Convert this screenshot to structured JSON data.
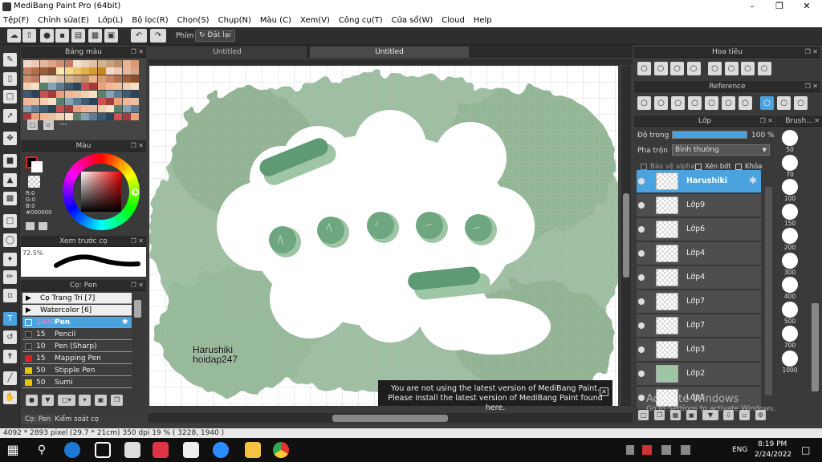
{
  "window": {
    "title": "MediBang Paint Pro (64bit)"
  },
  "menu": [
    "Tệp(F)",
    "Chỉnh sửa(E)",
    "Lớp(L)",
    "Bộ lọc(R)",
    "Chọn(S)",
    "Chụp(N)",
    "Màu (C)",
    "Xem(V)",
    "Công cụ(T)",
    "Cửa sổ(W)",
    "Cloud",
    "Help"
  ],
  "toolbar": {
    "shortcut_label": "Phím",
    "reset_label": "Đặt lại"
  },
  "panels": {
    "palette_title": "Bảng màu",
    "palette_footer": "---",
    "color_title": "Màu",
    "color_values": {
      "r": "R:0",
      "g": "G:0",
      "b": "B:0",
      "hex": "#000000"
    },
    "preview_title": "Xem trước cọ",
    "preview_zoom": "72.5%",
    "brush_title": "Cọ: Pen",
    "brush_groups": [
      "Cọ Trang Trí [7]",
      "Watercolor [6]"
    ],
    "brushes": [
      {
        "size": "1000",
        "name": "Pen",
        "color": "#ffffff",
        "selected": true
      },
      {
        "size": "15",
        "name": "Pencil",
        "color": "#333333"
      },
      {
        "size": "10",
        "name": "Pen (Sharp)",
        "color": "#333333"
      },
      {
        "size": "15",
        "name": "Mapping Pen",
        "color": "#e02020"
      },
      {
        "size": "50",
        "name": "Stipple Pen",
        "color": "#e8c800"
      },
      {
        "size": "50",
        "name": "Sumi",
        "color": "#e8c800"
      }
    ],
    "bottom_tabs": [
      "Cọ: Pen",
      "Kiểm soát cọ"
    ]
  },
  "canvas": {
    "tabs": [
      "Untitled",
      "Untitled"
    ],
    "signature_line1": "Harushiki",
    "signature_line2": "hoidap247"
  },
  "notice": {
    "line1": "You are not using the latest version of MediBang Paint.",
    "line2": "Please install the latest version of MediBang Paint found here."
  },
  "right": {
    "navigator_title": "Hoa tiêu",
    "reference_title": "Reference",
    "layer_title": "Lớp",
    "opacity_label": "Độ trong",
    "opacity_value": "100 %",
    "opacity": 1.0,
    "blend_label": "Pha trộn",
    "blend_value": "Bình thường",
    "checks": [
      "Bảo vệ alpha",
      "Xén bớt",
      "Khóa"
    ],
    "layers": [
      {
        "name": "Harushiki",
        "selected": true
      },
      {
        "name": "Lớp9"
      },
      {
        "name": "Lớp6"
      },
      {
        "name": "Lớp4"
      },
      {
        "name": "Lớp4"
      },
      {
        "name": "Lớp7"
      },
      {
        "name": "Lớp7"
      },
      {
        "name": "Lớp3"
      },
      {
        "name": "Lớp2"
      },
      {
        "name": "Lớp1"
      }
    ],
    "watermark1": "Activate Windows",
    "watermark2": "Go to Settings to activate Windows.",
    "brush_size_title": "Brush...",
    "brush_sizes": [
      "50",
      "70",
      "100",
      "150",
      "200",
      "300",
      "400",
      "500",
      "700",
      "1000"
    ]
  },
  "status": "4092 * 2893 pixel   (29.7 * 21cm)   350 dpi   19 %   ( 3228, 1940 )",
  "taskbar": {
    "lang": "ENG",
    "time": "8:19 PM",
    "date": "2/24/2022"
  },
  "colors": {
    "accent": "#4aa3df",
    "green": "#7fa882",
    "dark_green": "#5e9a74",
    "bg": "#3c3c3c"
  }
}
